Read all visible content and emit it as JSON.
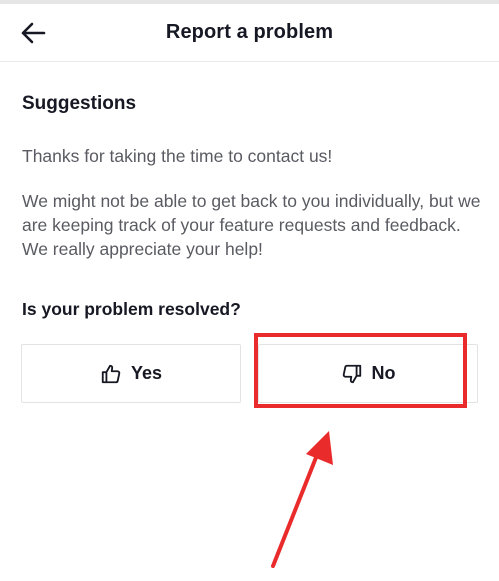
{
  "header": {
    "title": "Report a problem",
    "back_icon": "arrow-left-icon"
  },
  "content": {
    "section_title": "Suggestions",
    "paragraph_1": "Thanks for taking the time to contact us!",
    "paragraph_2": "We might not be able to get back to you individually, but we are keeping track of your feature requests and feedback. We really appreciate your help!",
    "question": "Is your problem resolved?"
  },
  "choices": {
    "yes_label": "Yes",
    "yes_icon": "thumbs-up-icon",
    "no_label": "No",
    "no_icon": "thumbs-down-icon"
  },
  "annotation": {
    "highlight_color": "#ea2b2b",
    "highlight_target": "No"
  }
}
